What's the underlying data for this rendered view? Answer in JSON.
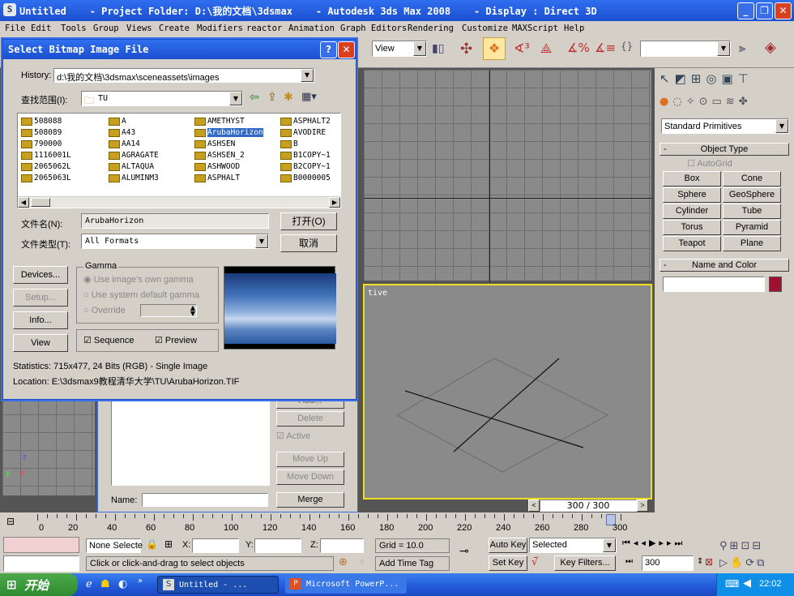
{
  "window": {
    "title": "Untitled    - Project Folder: D:\\我的文档\\3dsmax    - Autodesk 3ds Max 2008    - Display : Direct 3D"
  },
  "menu": [
    "File",
    "Edit",
    "Tools",
    "Group",
    "Views",
    "Create",
    "Modifiers",
    "reactor",
    "Animation",
    "Graph Editors",
    "Rendering",
    "Customize",
    "MAXScript",
    "Help"
  ],
  "toolbar": {
    "view_label": "View"
  },
  "dialog": {
    "title": "Select Bitmap Image File",
    "history_label": "History:",
    "history_value": "d:\\我的文档\\3dsmax\\sceneassets\\images",
    "lookin_label": "查找范围(I):",
    "lookin_value": "TU",
    "files": [
      [
        "508088",
        "508089",
        "790000",
        "1116001L",
        "2065062L",
        "2065063L"
      ],
      [
        "A",
        "A43",
        "AA14",
        "AGRAGATE",
        "ALTAQUA",
        "ALUMINM3"
      ],
      [
        "AMETHYST",
        "ArubaHorizon",
        "ASHSEN",
        "ASHSEN_2",
        "ASHWOOD",
        "ASPHALT"
      ],
      [
        "ASPHALT2",
        "AVODIRE",
        "B",
        "B1COPY~1",
        "B2COPY~1",
        "B0000005"
      ]
    ],
    "filename_label": "文件名(N):",
    "filename_value": "ArubaHorizon",
    "filetype_label": "文件类型(T):",
    "filetype_value": "All Formats",
    "open_button": "打开(O)",
    "cancel_button": "取消",
    "devices_button": "Devices...",
    "setup_button": "Setup...",
    "info_button": "Info...",
    "view_button": "View",
    "gamma_label": "Gamma",
    "gamma_opt1": "Use image's own gamma",
    "gamma_opt2": "Use system default gamma",
    "gamma_opt3": "Override",
    "sequence_label": "Sequence",
    "preview_label": "Preview",
    "statistics": "Statistics: 715x477, 24 Bits (RGB) - Single Image",
    "location": "Location: E:\\3dsmax9教程清华大学\\TU\\ArubaHorizon.TIF"
  },
  "behind": {
    "add_button": "Add...",
    "delete_button": "Delete",
    "active_label": "Active",
    "move_up": "Move Up",
    "move_down": "Move Down",
    "name_label": "Name:",
    "merge_button": "Merge"
  },
  "viewport": {
    "persp_label": "tive",
    "frame_counter": "300 / 300"
  },
  "command_panel": {
    "dropdown": "Standard Primitives",
    "object_type": "Object Type",
    "autogrid": "AutoGrid",
    "buttons": [
      "Box",
      "Cone",
      "Sphere",
      "GeoSphere",
      "Cylinder",
      "Tube",
      "Torus",
      "Pyramid",
      "Teapot",
      "Plane"
    ],
    "name_color": "Name and Color"
  },
  "timeline": {
    "ticks": [
      "0",
      "20",
      "40",
      "60",
      "80",
      "100",
      "120",
      "140",
      "160",
      "180",
      "200",
      "220",
      "240",
      "260",
      "280",
      "300"
    ]
  },
  "status": {
    "selection": "None Selecte",
    "x_label": "X:",
    "y_label": "Y:",
    "z_label": "Z:",
    "grid": "Grid = 10.0",
    "autokey": "Auto Key",
    "selected": "Selected",
    "setkey": "Set Key",
    "keyfilters": "Key Filters...",
    "frame": "300",
    "prompt": "Click or click-and-drag to select objects",
    "add_time_tag": "Add Time Tag"
  },
  "taskbar": {
    "start": "开始",
    "task1": "Untitled    - ...",
    "task2": "Microsoft PowerP...",
    "clock": "22:02"
  }
}
